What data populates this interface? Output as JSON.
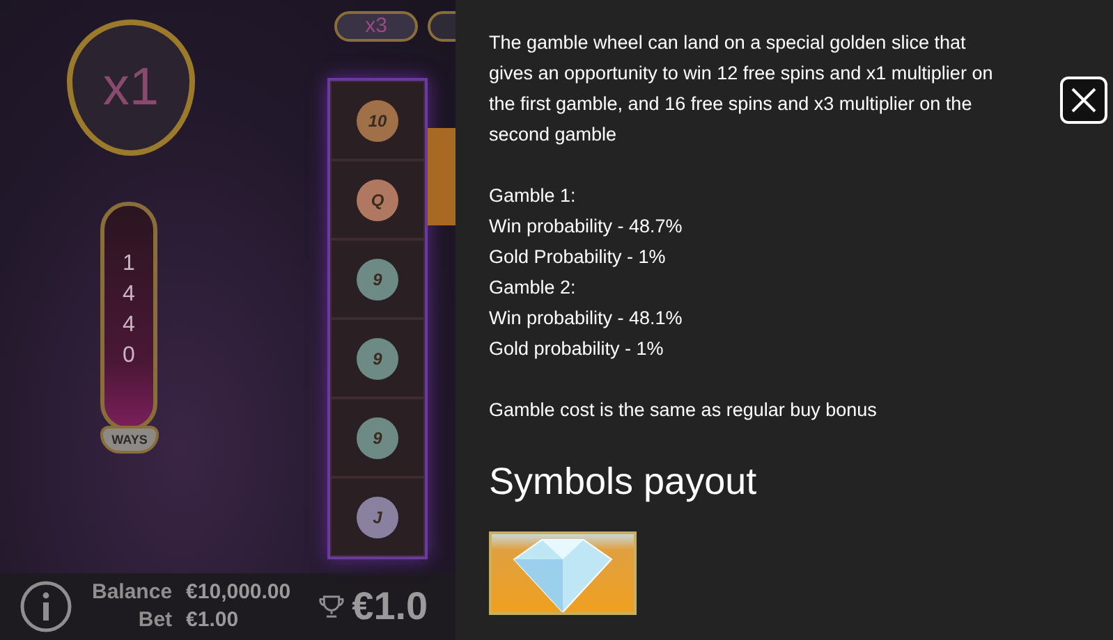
{
  "game": {
    "multiplier": "x1",
    "top_multipliers": [
      "x3"
    ],
    "ways_digits": [
      "1",
      "4",
      "4",
      "0"
    ],
    "ways_label": "WAYS",
    "reel_symbols": [
      "10",
      "Q",
      "9",
      "9",
      "9",
      "J"
    ]
  },
  "bottom_bar": {
    "balance_label": "Balance",
    "balance": "€10,000.00",
    "bet_label": "Bet",
    "bet": "€1.00",
    "win": "€1.0"
  },
  "info_panel": {
    "paragraphs": [
      [
        "The gamble wheel can land on a special golden slice that gives an opportunity to win 12 free spins and x1 multiplier on the first gamble, and 16 free spins and x3 multiplier on the second gamble"
      ],
      [
        "Gamble 1:",
        "Win probability - 48.7%",
        "Gold Probability - 1%",
        "Gamble 2:",
        "Win probability - 48.1%",
        "Gold probability - 1%"
      ],
      [
        "Gamble cost is the same as regular buy bonus"
      ]
    ],
    "heading": "Symbols payout"
  }
}
